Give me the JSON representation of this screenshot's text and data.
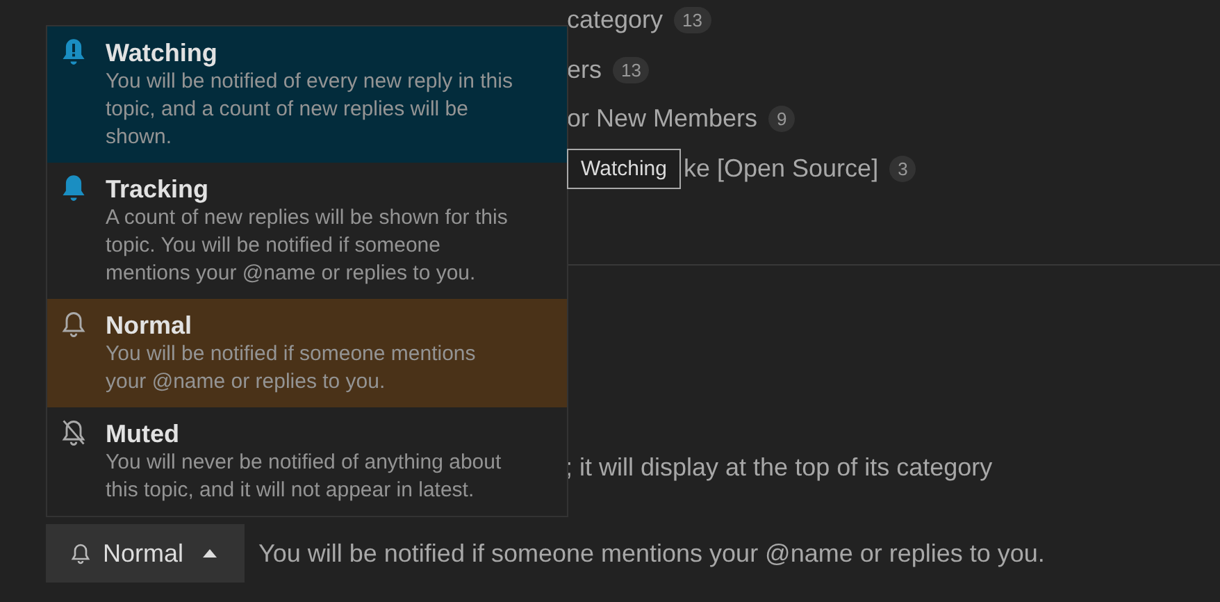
{
  "topic_list": [
    {
      "title": "category",
      "count": "13"
    },
    {
      "title": "ers",
      "count": "13"
    },
    {
      "title": "or New Members",
      "count": "9"
    },
    {
      "title": "ke [Open Source]",
      "count": "3",
      "tooltip": "Watching"
    }
  ],
  "pin_note": "; it will display at the top of its category",
  "notification_menu": {
    "options": [
      {
        "title": "Watching",
        "description": "You will be notified of every new reply in this topic, and a count of new replies will be shown.",
        "hovered": true,
        "selected": false
      },
      {
        "title": "Tracking",
        "description": "A count of new replies will be shown for this topic. You will be notified if someone mentions your @name or replies to you.",
        "hovered": false,
        "selected": false
      },
      {
        "title": "Normal",
        "description": "You will be notified if someone mentions your @name or replies to you.",
        "hovered": false,
        "selected": true
      },
      {
        "title": "Muted",
        "description": "You will never be notified of anything about this topic, and it will not appear in latest.",
        "hovered": false,
        "selected": false
      }
    ]
  },
  "notification_button": {
    "label": "Normal",
    "expanded": true
  },
  "notification_reason": "You will be notified if someone mentions your @name or replies to you."
}
